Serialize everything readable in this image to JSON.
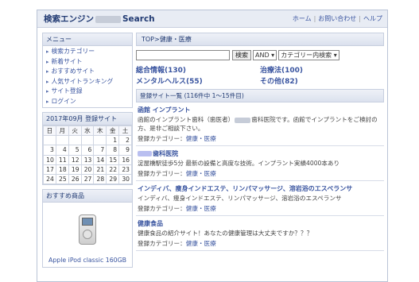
{
  "header": {
    "title_prefix": "検索エンジン",
    "title_suffix": "Search",
    "links": [
      "ホーム",
      "お問い合わせ",
      "ヘルプ"
    ]
  },
  "sidebar": {
    "menu_title": "メニュー",
    "menu_items": [
      "検索カテゴリー",
      "新着サイト",
      "おすすめサイト",
      "人気サイトランキング",
      "サイト登録",
      "ログイン"
    ],
    "calendar_title": "2017年09月 登録サイト",
    "weekdays": [
      "日",
      "月",
      "火",
      "水",
      "木",
      "金",
      "土"
    ],
    "weeks": [
      [
        "",
        "",
        "",
        "",
        "",
        "1",
        "2"
      ],
      [
        "3",
        "4",
        "5",
        "6",
        "7",
        "8",
        "9"
      ],
      [
        "10",
        "11",
        "12",
        "13",
        "14",
        "15",
        "16"
      ],
      [
        "17",
        "18",
        "19",
        "20",
        "21",
        "22",
        "23"
      ],
      [
        "24",
        "25",
        "26",
        "27",
        "28",
        "29",
        "30"
      ]
    ],
    "product_title": "おすすめ商品",
    "product_name": "Apple iPod classic 160GB"
  },
  "main": {
    "breadcrumb": "TOP>健康・医療",
    "search": {
      "value": "",
      "button": "検索",
      "mode": "AND",
      "scope": "カテゴリー内検索"
    },
    "categories": [
      "総合情報(130)",
      "治療法(100)",
      "メンタルヘルス(55)",
      "その他(82)"
    ],
    "list_header": "登録サイト一覧 (116件中 1～15件目)",
    "category_prefix": "登録カテゴリー：",
    "entries": [
      {
        "title": "函館 インプラント",
        "desc_a": "函館のインプラント歯科（歯医者）",
        "desc_b": "歯科医院です。函館でインプラントをご検討の方、是非ご相談下さい。",
        "category": "健康・医療"
      },
      {
        "title_suffix": "歯科医院",
        "desc": "淀屋橋駅徒歩5分 最新の設備と高度な技術。インプラント実績4000本あり",
        "category": "健康・医療"
      },
      {
        "title": "インディバ、痩身インドエステ、リンパマッサージ、溶岩浴のエスペランサ",
        "desc": "インディバ、痩身インドエステ、リンパマッサージ、溶岩浴のエスペランサ",
        "category": "健康・医療"
      },
      {
        "title": "健康食品",
        "desc": "健康食品の紹介サイト！あなたの健康管理は大丈夫ですか？？？",
        "category": "健康・医療"
      }
    ]
  }
}
